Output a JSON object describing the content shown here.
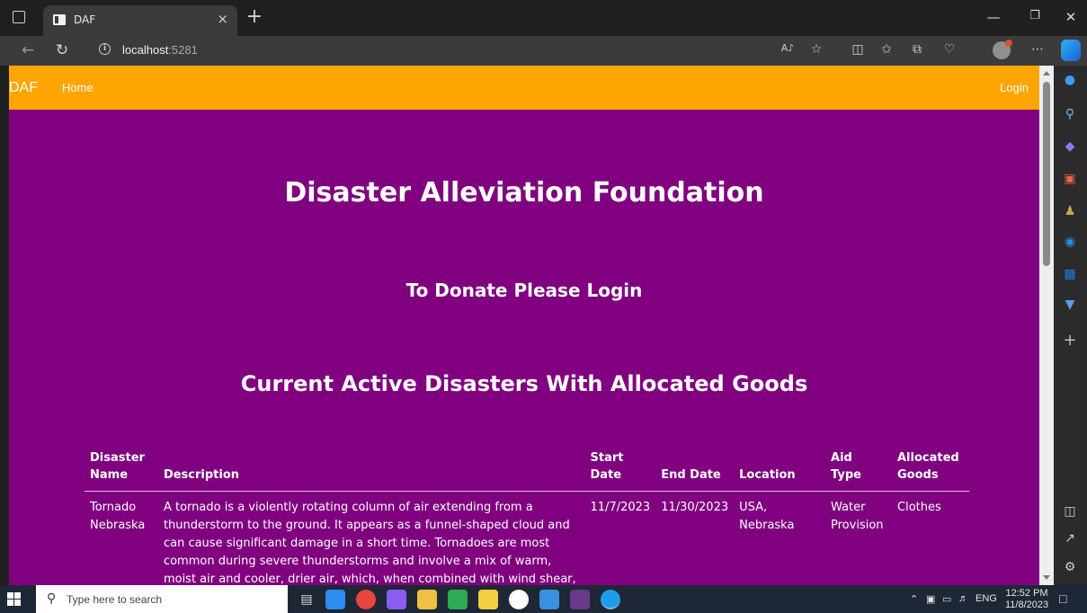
{
  "browser": {
    "tab_title": "DAF",
    "tab_close": "×",
    "new_tab": "+",
    "address_host": "localhost",
    "address_port": ":5281"
  },
  "site": {
    "brand": "DAF",
    "nav_home": "Home",
    "nav_login": "Login",
    "heading": "Disaster Alleviation Foundation",
    "subheading": "To Donate Please Login",
    "section_heading": "Current Active Disasters With Allocated Goods"
  },
  "table": {
    "headers": {
      "name_1": "Disaster",
      "name_2": "Name",
      "description": "Description",
      "start_1": "Start",
      "start_2": "Date",
      "end": "End Date",
      "location": "Location",
      "aid": "Aid Type",
      "goods_1": "Allocated",
      "goods_2": "Goods"
    },
    "rows": [
      {
        "name": "Tornado Nebraska",
        "description": "A tornado is a violently rotating column of air extending from a thunderstorm to the ground. It appears as a funnel-shaped cloud and can cause significant damage in a short time. Tornadoes are most common during severe thunderstorms and involve a mix of warm, moist air and cooler, drier air, which, when combined with wind shear, can lead to their",
        "start_date": "11/7/2023",
        "end_date": "11/30/2023",
        "location": "USA, Nebraska",
        "aid_type": "Water Provision",
        "goods": "Clothes"
      }
    ]
  },
  "taskbar": {
    "search_placeholder": "Type here to search",
    "tray_lang": "ENG",
    "time": "12:52 PM",
    "date": "11/8/2023"
  },
  "colors": {
    "navbar": "#FFA500",
    "page_bg": "#800080"
  }
}
